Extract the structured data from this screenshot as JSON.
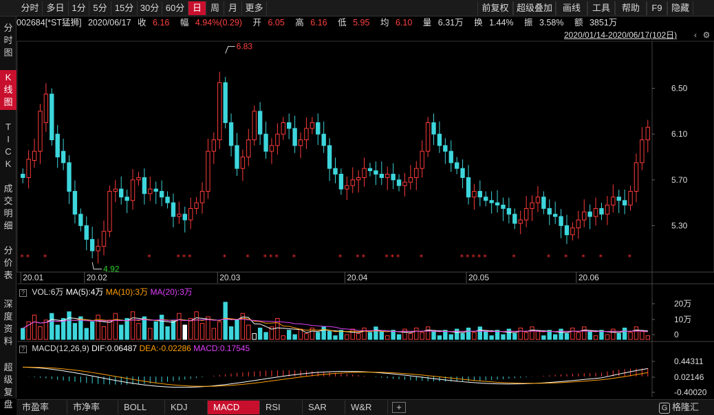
{
  "toolbar": {
    "periods": [
      "分时",
      "多日",
      "1分",
      "5分",
      "15分",
      "30分",
      "60分",
      "日",
      "周",
      "月",
      "更多"
    ],
    "active_period": "日",
    "right_items": [
      "前复权",
      "超级叠加",
      "画线",
      "工具",
      "帮助",
      "F9",
      "隐藏"
    ]
  },
  "leftbar": {
    "groups": [
      {
        "label": "分时图",
        "active": false
      },
      {
        "label": "K线图",
        "active": true
      },
      {
        "label": "TICK",
        "active": false
      },
      {
        "label": "成交明细",
        "active": false
      },
      {
        "label": "分价表",
        "active": false
      },
      {
        "label": "深度资料",
        "active": false
      },
      {
        "label": "超级复盘",
        "active": false
      }
    ]
  },
  "quote": {
    "code_name": "002684[*ST猛狮]",
    "date": "2020/06/17",
    "close_label": "收",
    "close": "6.16",
    "amp_label": "幅",
    "amp": "4.94%(0.29)",
    "open_label": "开",
    "open": "6.05",
    "high_label": "高",
    "high": "6.16",
    "low_label": "低",
    "low": "5.95",
    "avg_label": "均",
    "avg": "6.10",
    "vol_label": "量",
    "vol": "6.31万",
    "turn_label": "换",
    "turn": "1.44%",
    "swing_label": "振",
    "swing": "3.58%",
    "amount_label": "额",
    "amount": "3851万"
  },
  "range_text": "2020/01/14-2020/06/17(102日)",
  "price_axis": {
    "ticks": [
      "6.50",
      "6.10",
      "5.70",
      "5.30"
    ],
    "values": [
      6.5,
      6.1,
      5.7,
      5.3
    ]
  },
  "date_axis": [
    "20.01",
    "20.02",
    "20.03",
    "20.04",
    "20.05",
    "20.06"
  ],
  "annotations": {
    "high": "6.83",
    "low": "4.92"
  },
  "volume_panel": {
    "vol_label": "VOL:6万",
    "ma5_label": "MA(5):4万",
    "ma10_label": "MA(10):3万",
    "ma20_label": "MA(20):3万",
    "axis": [
      "20万",
      "10万",
      "0"
    ]
  },
  "macd_panel": {
    "label": "MACD(12,26,9)",
    "dif_label": "DIF:0.06487",
    "dea_label": "DEA:-0.02286",
    "macd_label": "MACD:0.17545",
    "axis": [
      "0.44311",
      "0.02146",
      "-0.40020"
    ]
  },
  "indicator_tabs": [
    "市盈率",
    "市净率",
    "BOLL",
    "KDJ",
    "MACD",
    "RSI",
    "SAR",
    "W&R"
  ],
  "active_tab": "MACD",
  "logo": "格隆汇",
  "colors": {
    "up": "#ff3b3b",
    "down": "#3dd6dc",
    "ma5": "#ffffff",
    "ma10": "#ffa000",
    "ma20": "#e040fb",
    "accent": "#c8102e"
  },
  "chart_data": {
    "type": "candlestick",
    "x": [
      "20.01",
      "",
      "",
      "",
      "",
      "",
      "",
      "",
      "",
      "",
      "",
      "20.02",
      "",
      "",
      "",
      "",
      "",
      "",
      "",
      "",
      "",
      "",
      "",
      "",
      "",
      "",
      "",
      "",
      "",
      "",
      "",
      "",
      "",
      "",
      "20.03",
      "",
      "",
      "",
      "",
      "",
      "",
      "",
      "",
      "",
      "",
      "",
      "",
      "",
      "",
      "",
      "",
      "",
      "",
      "",
      "",
      "",
      "20.04",
      "",
      "",
      "",
      "",
      "",
      "",
      "",
      "",
      "",
      "",
      "",
      "",
      "",
      "",
      "",
      "",
      "",
      "",
      "",
      "",
      "20.05",
      "",
      "",
      "",
      "",
      "",
      "",
      "",
      "",
      "",
      "",
      "",
      "",
      "",
      "",
      "",
      "",
      "",
      "",
      "20.06",
      "",
      "",
      "",
      "",
      "",
      "",
      "",
      "",
      "",
      "",
      "",
      "",
      "",
      ""
    ],
    "series": [
      {
        "values_open": [
          5.75,
          5.72,
          5.87,
          5.95,
          6.2,
          6.45,
          6.1,
          5.95,
          5.85,
          5.6,
          5.4,
          5.3,
          5.18,
          5.08,
          5.12,
          5.25,
          5.6,
          5.62,
          5.55,
          5.52,
          5.7,
          5.72,
          5.58,
          5.62,
          5.6,
          5.55,
          5.5,
          5.38,
          5.4,
          5.35,
          5.45,
          5.5,
          5.6,
          5.95,
          6.05,
          6.55,
          6.2,
          6.0,
          5.8,
          5.9,
          6.05,
          6.3,
          6.1,
          5.95,
          6.0,
          6.1,
          6.2,
          6.15,
          6.0,
          6.05,
          6.15,
          6.2,
          6.1,
          6.0,
          5.8,
          5.75,
          5.62,
          5.65,
          5.7,
          5.72,
          5.8,
          5.78,
          5.75,
          5.72,
          5.75,
          5.7,
          5.65,
          5.68,
          5.72,
          5.8,
          5.95,
          6.2,
          6.1,
          6.0,
          5.95,
          5.85,
          5.8,
          5.72,
          5.55,
          5.6,
          5.55,
          5.52,
          5.5,
          5.48,
          5.45,
          5.4,
          5.32,
          5.35,
          5.45,
          5.5,
          5.55,
          5.45,
          5.4,
          5.38,
          5.3,
          5.22,
          5.28,
          5.35,
          5.42,
          5.38,
          5.45,
          5.4,
          5.48,
          5.55,
          5.52,
          5.48,
          5.6,
          5.85,
          6.05
        ],
        "values_close": [
          5.72,
          5.88,
          5.95,
          6.3,
          6.45,
          6.05,
          5.9,
          5.85,
          5.6,
          5.4,
          5.3,
          5.18,
          5.08,
          5.12,
          5.25,
          5.6,
          5.62,
          5.55,
          5.52,
          5.7,
          5.72,
          5.58,
          5.62,
          5.6,
          5.55,
          5.5,
          5.38,
          5.4,
          5.35,
          5.45,
          5.5,
          5.6,
          5.95,
          6.05,
          6.55,
          6.2,
          6.0,
          5.8,
          5.9,
          6.05,
          6.3,
          6.1,
          5.95,
          6.0,
          6.1,
          6.2,
          6.15,
          6.0,
          6.05,
          6.15,
          6.2,
          6.1,
          6.0,
          5.8,
          5.75,
          5.62,
          5.65,
          5.7,
          5.72,
          5.8,
          5.78,
          5.75,
          5.72,
          5.75,
          5.7,
          5.65,
          5.68,
          5.72,
          5.8,
          5.95,
          6.2,
          6.1,
          6.0,
          5.95,
          5.85,
          5.8,
          5.72,
          5.55,
          5.6,
          5.55,
          5.52,
          5.5,
          5.48,
          5.45,
          5.4,
          5.32,
          5.35,
          5.45,
          5.5,
          5.55,
          5.45,
          5.4,
          5.38,
          5.3,
          5.22,
          5.28,
          5.35,
          5.42,
          5.38,
          5.45,
          5.4,
          5.48,
          5.55,
          5.52,
          5.48,
          5.6,
          5.85,
          6.05,
          6.16
        ]
      }
    ],
    "ylim": [
      4.9,
      6.9
    ]
  }
}
